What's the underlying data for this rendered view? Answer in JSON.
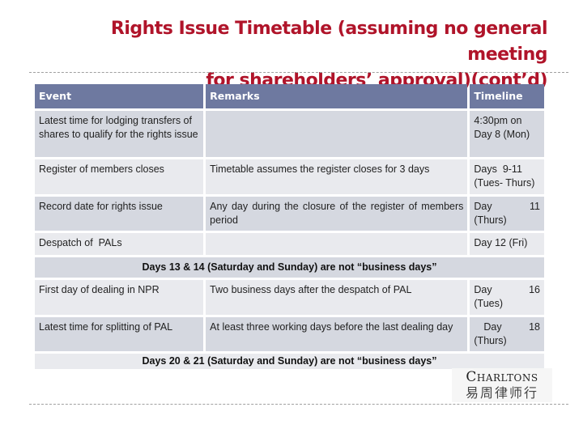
{
  "title": {
    "line1": "Rights Issue Timetable (assuming no general meeting",
    "line2": "for shareholders’ approval)(cont’d)"
  },
  "table": {
    "headers": [
      "Event",
      "Remarks",
      "Timeline"
    ],
    "rows": [
      {
        "event": "Latest time for lodging transfers of shares to qualify for the rights issue",
        "remarks": "",
        "timeline_a": "4:30pm on",
        "timeline_b": "Day 8 (Mon)"
      },
      {
        "event": "Register of members closes",
        "remarks": "Timetable assumes the register closes for 3 days",
        "timeline_a": "Days  9-11",
        "timeline_b": "(Tues- Thurs)"
      },
      {
        "event": "Record date for rights issue",
        "remarks": "Any day during the closure of the register of members period",
        "timeline_a": "Day",
        "timeline_n": "11",
        "timeline_b": "(Thurs)"
      },
      {
        "event": "Despatch of  PALs",
        "remarks": "",
        "timeline_a": "Day 12 (Fri)"
      }
    ],
    "notice1": "Days 13 & 14 (Saturday and Sunday) are not “business days”",
    "rows2": [
      {
        "event": "First day of dealing in NPR",
        "remarks": "Two business days after the despatch of PAL",
        "timeline_a": "Day",
        "timeline_n": "16",
        "timeline_b": "(Tues)"
      },
      {
        "event": "Latest time for splitting of PAL",
        "remarks": "At least three working days before the last dealing day",
        "timeline_a": "Day",
        "timeline_n": "18",
        "timeline_b": "(Thurs)"
      }
    ],
    "notice2": "Days 20 & 21 (Saturday and Sunday) are not “business days”"
  },
  "logo": {
    "english": "Charltons",
    "chinese": "易周律师行"
  }
}
